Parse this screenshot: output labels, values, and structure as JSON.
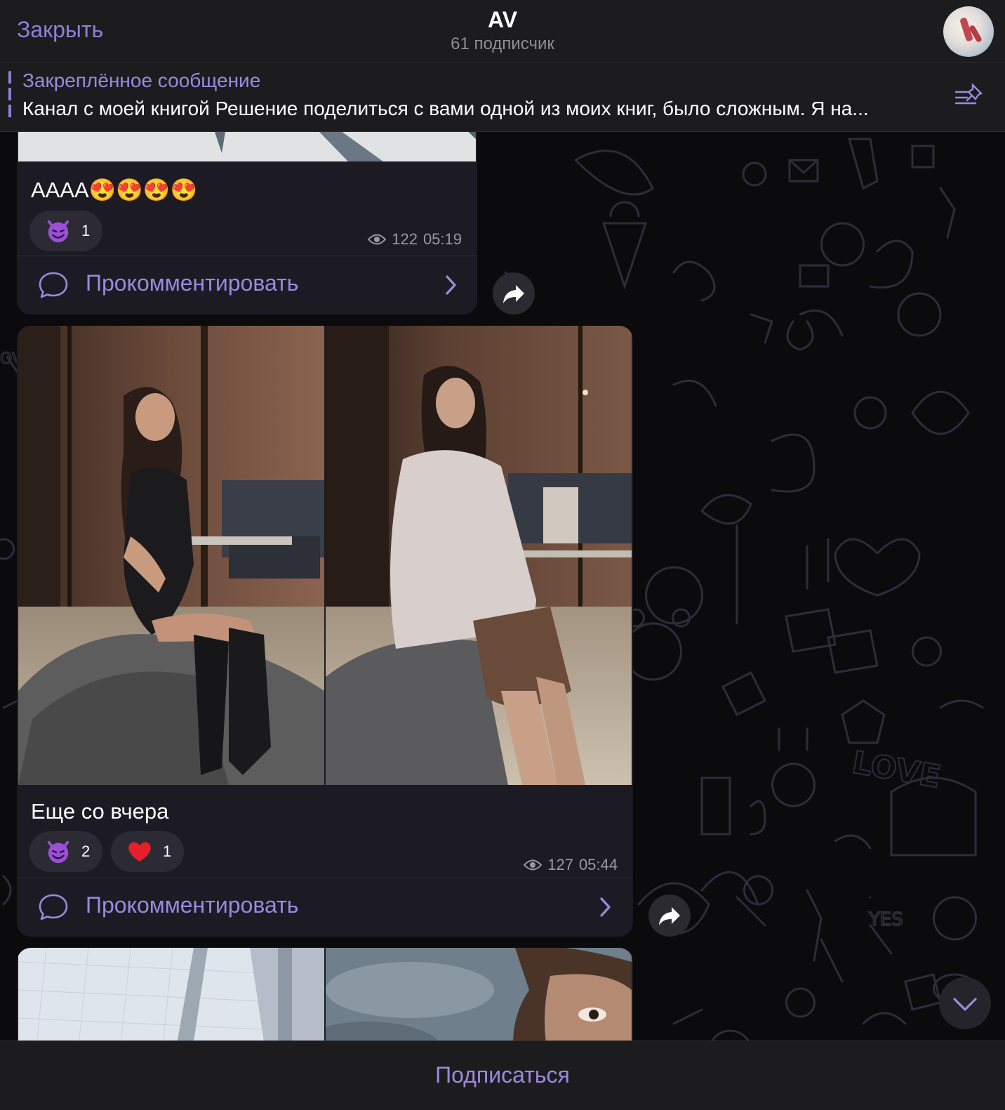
{
  "header": {
    "close_label": "Закрыть",
    "title": "AV",
    "subtitle": "61 подписчик"
  },
  "pinned": {
    "title": "Закреплённое сообщение",
    "text": "Канал с моей книгой Решение поделиться с вами одной из моих книг, было сложным. Я на..."
  },
  "messages": [
    {
      "text": "AAAA😍😍😍😍",
      "reactions": [
        {
          "emoji_icon": "smiling-devil-icon",
          "count": "1"
        }
      ],
      "views": "122",
      "time": "05:19",
      "comment_label": "Прокомментировать"
    },
    {
      "text": "Еще со вчера",
      "reactions": [
        {
          "emoji_icon": "smiling-devil-icon",
          "count": "2"
        },
        {
          "emoji_icon": "red-heart-icon",
          "count": "1"
        }
      ],
      "views": "127",
      "time": "05:44",
      "comment_label": "Прокомментировать"
    }
  ],
  "footer": {
    "subscribe_label": "Подписаться"
  },
  "colors": {
    "accent": "#9a8ae0",
    "bubble": "#1c1b24",
    "bar": "#1c1c1e"
  }
}
